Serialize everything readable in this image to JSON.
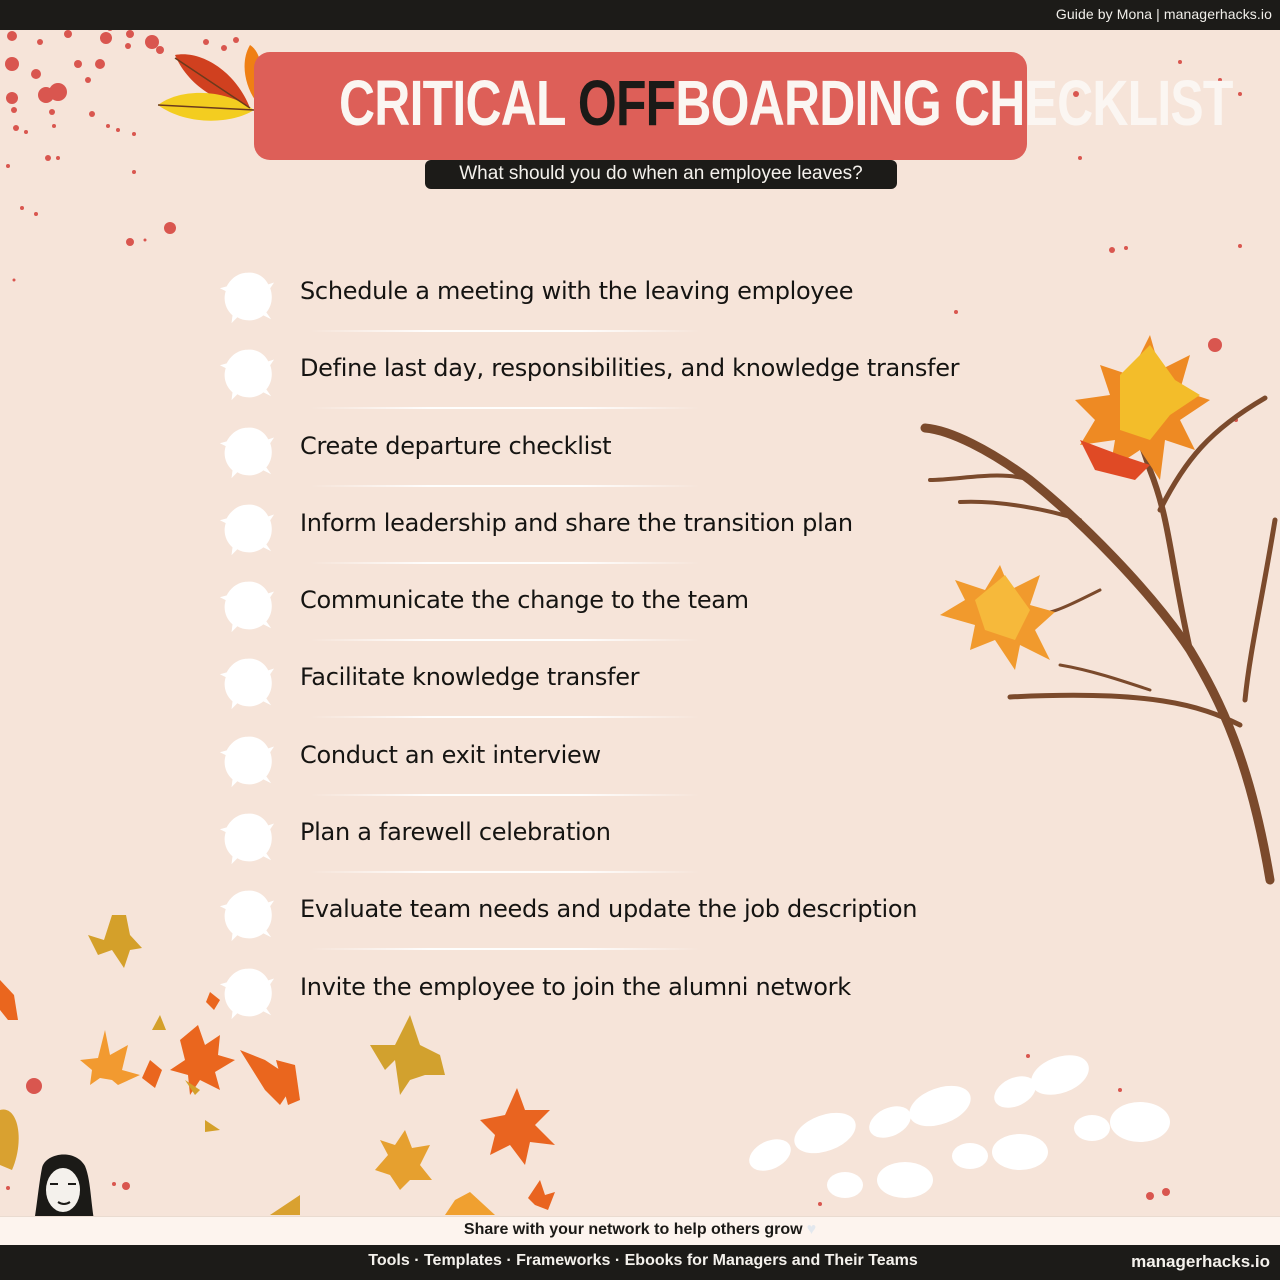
{
  "header": {
    "credit": "Guide by Mona | managerhacks.io"
  },
  "title": {
    "part1": "CRITICAL ",
    "highlight": "OFF",
    "part2": "BOARDING CHECKLIST",
    "subtitle": "What should you do when an employee leaves?"
  },
  "checklist": {
    "items": [
      {
        "label": "Schedule a meeting with the leaving employee",
        "checked": false
      },
      {
        "label": "Define last day, responsibilities, and knowledge transfer",
        "checked": false
      },
      {
        "label": "Create departure checklist",
        "checked": false
      },
      {
        "label": "Inform leadership and share the transition plan",
        "checked": false
      },
      {
        "label": "Communicate the change to the team",
        "checked": false
      },
      {
        "label": "Facilitate knowledge transfer",
        "checked": false
      },
      {
        "label": "Conduct an exit interview",
        "checked": false
      },
      {
        "label": "Plan a farewell celebration",
        "checked": false
      },
      {
        "label": "Evaluate team needs and update the job description",
        "checked": false
      },
      {
        "label": "Invite the employee to join the alumni network",
        "checked": false
      }
    ]
  },
  "footer": {
    "share": "Share with your network to help others grow",
    "heart_icon": "heart-icon",
    "tagline": "Tools · Templates · Frameworks · Ebooks for Managers and Their Teams",
    "site": "managerhacks.io"
  },
  "colors": {
    "background": "#f6e4d9",
    "accent": "#dd5f58",
    "dark": "#1c1b18"
  }
}
